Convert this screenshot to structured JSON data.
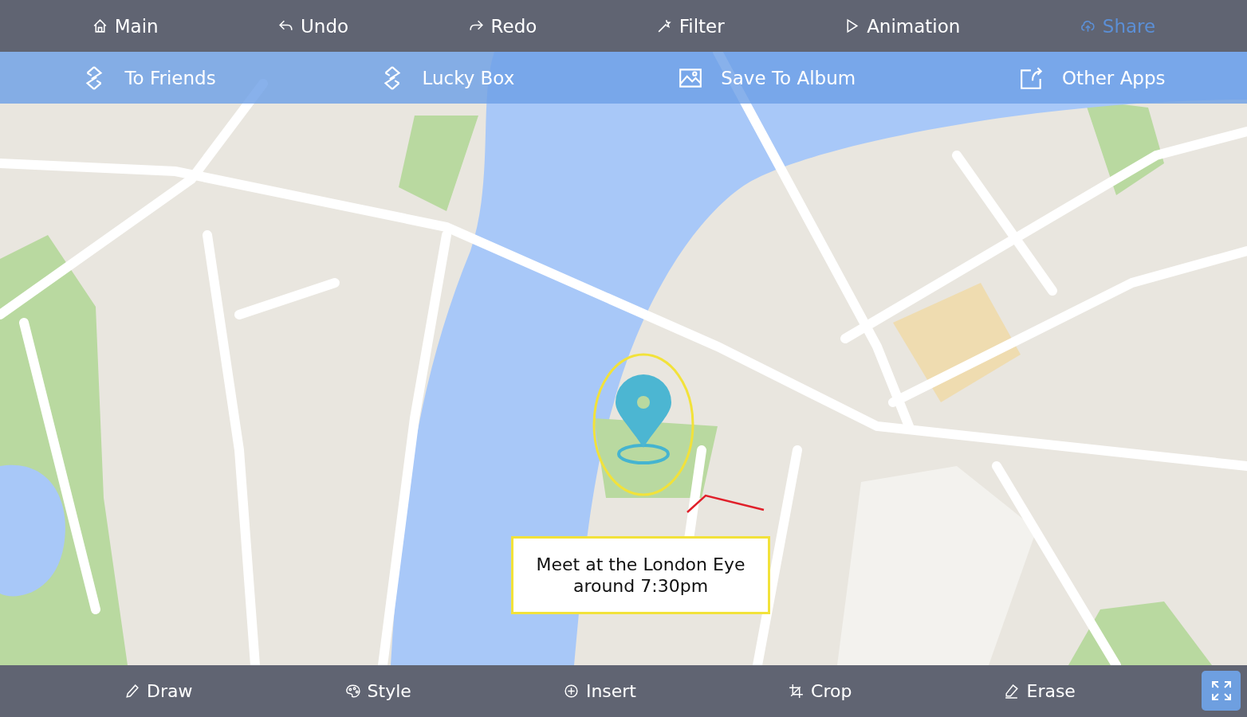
{
  "toolbar": [
    {
      "label": "Main",
      "selected": false
    },
    {
      "label": "Undo",
      "selected": false
    },
    {
      "label": "Redo",
      "selected": false
    },
    {
      "label": "Filter",
      "selected": false
    },
    {
      "label": "Animation",
      "selected": false
    },
    {
      "label": "Share",
      "selected": true
    }
  ],
  "share_menu": [
    {
      "label": "To Friends"
    },
    {
      "label": "Lucky Box"
    },
    {
      "label": "Save To Album"
    },
    {
      "label": "Other Apps"
    }
  ],
  "note": {
    "lines": [
      "Meet at the London Eye",
      "around 7:30pm"
    ]
  },
  "bottom_toolbar": [
    {
      "label": "Draw"
    },
    {
      "label": "Style"
    },
    {
      "label": "Insert"
    },
    {
      "label": "Crop"
    },
    {
      "label": "Erase"
    }
  ]
}
